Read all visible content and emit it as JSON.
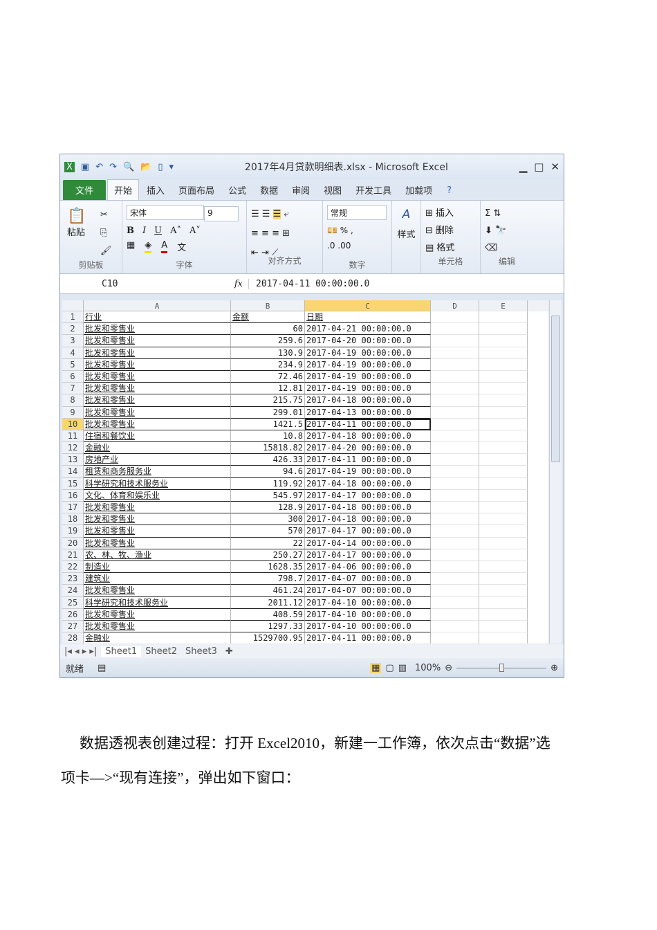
{
  "window": {
    "title": "2017年4月贷款明细表.xlsx - Microsoft Excel"
  },
  "tabs": [
    "文件",
    "开始",
    "插入",
    "页面布局",
    "公式",
    "数据",
    "审阅",
    "视图",
    "开发工具",
    "加载项"
  ],
  "ribbon": {
    "paste": "粘贴",
    "font_name": "宋体",
    "font_size": "9",
    "number_format": "常规",
    "styles": "样式",
    "insert": "插入",
    "delete": "删除",
    "format": "格式",
    "groups": [
      "剪贴板",
      "字体",
      "对齐方式",
      "数字",
      "单元格",
      "编辑"
    ]
  },
  "formula_bar": {
    "name_box": "C10",
    "fx": "fx",
    "value": "2017-04-11  00:00:00.0"
  },
  "columns": [
    "A",
    "B",
    "C",
    "D",
    "E"
  ],
  "headers": [
    "行业",
    "金额",
    "日期"
  ],
  "rows": [
    [
      "2",
      "批发和零售业",
      "60",
      "2017-04-21  00:00:00.0"
    ],
    [
      "3",
      "批发和零售业",
      "259.6",
      "2017-04-20  00:00:00.0"
    ],
    [
      "4",
      "批发和零售业",
      "130.9",
      "2017-04-19  00:00:00.0"
    ],
    [
      "5",
      "批发和零售业",
      "234.9",
      "2017-04-19  00:00:00.0"
    ],
    [
      "6",
      "批发和零售业",
      "72.46",
      "2017-04-19  00:00:00.0"
    ],
    [
      "7",
      "批发和零售业",
      "12.81",
      "2017-04-19  00:00:00.0"
    ],
    [
      "8",
      "批发和零售业",
      "215.75",
      "2017-04-18  00:00:00.0"
    ],
    [
      "9",
      "批发和零售业",
      "299.01",
      "2017-04-13  00:00:00.0"
    ],
    [
      "10",
      "批发和零售业",
      "1421.5",
      "2017-04-11  00:00:00.0"
    ],
    [
      "11",
      "住宿和餐饮业",
      "10.8",
      "2017-04-18  00:00:00.0"
    ],
    [
      "12",
      "金融业",
      "15818.82",
      "2017-04-20  00:00:00.0"
    ],
    [
      "13",
      "房地产业",
      "426.33",
      "2017-04-11  00:00:00.0"
    ],
    [
      "14",
      "租赁和商务服务业",
      "94.6",
      "2017-04-19  00:00:00.0"
    ],
    [
      "15",
      "科学研究和技术服务业",
      "119.92",
      "2017-04-18  00:00:00.0"
    ],
    [
      "16",
      "文化、体育和娱乐业",
      "545.97",
      "2017-04-17  00:00:00.0"
    ],
    [
      "17",
      "批发和零售业",
      "128.9",
      "2017-04-18  00:00:00.0"
    ],
    [
      "18",
      "批发和零售业",
      "300",
      "2017-04-18  00:00:00.0"
    ],
    [
      "19",
      "批发和零售业",
      "570",
      "2017-04-17  00:00:00.0"
    ],
    [
      "20",
      "批发和零售业",
      "22",
      "2017-04-14  00:00:00.0"
    ],
    [
      "21",
      "农、林、牧、渔业",
      "250.27",
      "2017-04-17  00:00:00.0"
    ],
    [
      "22",
      "制造业",
      "1628.35",
      "2017-04-06  00:00:00.0"
    ],
    [
      "23",
      "建筑业",
      "798.7",
      "2017-04-07  00:00:00.0"
    ],
    [
      "24",
      "批发和零售业",
      "461.24",
      "2017-04-07  00:00:00.0"
    ],
    [
      "25",
      "科学研究和技术服务业",
      "2011.12",
      "2017-04-10  00:00:00.0"
    ],
    [
      "26",
      "批发和零售业",
      "408.59",
      "2017-04-10  00:00:00.0"
    ],
    [
      "27",
      "批发和零售业",
      "1297.33",
      "2017-04-10  00:00:00.0"
    ],
    [
      "28",
      "金融业",
      "1529700.95",
      "2017-04-11  00:00:00.0"
    ]
  ],
  "sheets": [
    "Sheet1",
    "Sheet2",
    "Sheet3"
  ],
  "status": {
    "ready": "就绪",
    "zoom": "100%"
  },
  "paragraph": {
    "line1": "数据透视表创建过程：打开 Excel2010，新建一工作簿，依次点击“数据”选",
    "line2": "项卡—>“现有连接”，弹出如下窗口："
  }
}
